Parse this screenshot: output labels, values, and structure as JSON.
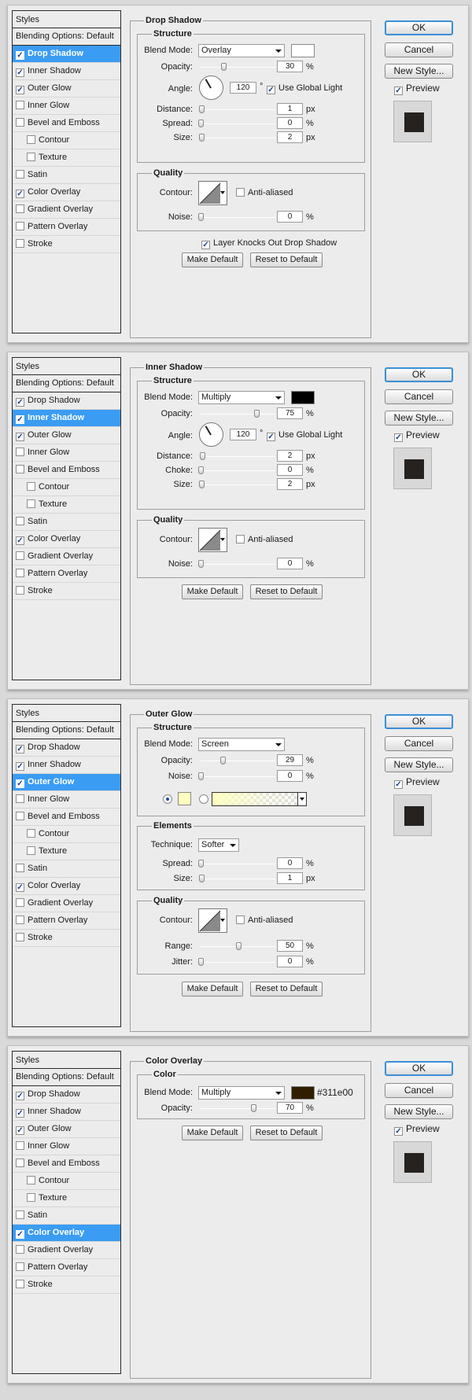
{
  "dialog": {
    "styles_header": "Styles",
    "blending_options": "Blending Options: Default",
    "style_items": [
      "Drop Shadow",
      "Inner Shadow",
      "Outer Glow",
      "Inner Glow",
      "Bevel and Emboss",
      "Contour",
      "Texture",
      "Satin",
      "Color Overlay",
      "Gradient Overlay",
      "Pattern Overlay",
      "Stroke"
    ],
    "ok_label": "OK",
    "cancel_label": "Cancel",
    "new_style_label": "New Style...",
    "preview_label": "Preview",
    "make_default_label": "Make Default",
    "reset_to_default_label": "Reset to Default",
    "checkmark": "✓",
    "preview_color": "#262220"
  },
  "panels": [
    {
      "selected": "Drop Shadow",
      "checked": [
        "Drop Shadow",
        "Inner Shadow",
        "Outer Glow",
        "Color Overlay"
      ],
      "group_title": "Drop Shadow",
      "structure_title": "Structure",
      "blend_mode_label": "Blend Mode:",
      "blend_mode": "Overlay",
      "swatch_color": "#ffffff",
      "opacity_label": "Opacity:",
      "opacity": "30",
      "opacity_unit": "%",
      "angle_label": "Angle:",
      "angle": "120",
      "angle_unit": "°",
      "use_global_light": "Use Global Light",
      "distance_label": "Distance:",
      "distance": "1",
      "distance_unit": "px",
      "spread_label": "Spread:",
      "spread": "0",
      "spread_unit": "%",
      "size_label": "Size:",
      "size": "2",
      "size_unit": "px",
      "quality_title": "Quality",
      "contour_label": "Contour:",
      "anti_aliased": "Anti-aliased",
      "noise_label": "Noise:",
      "noise": "0",
      "noise_unit": "%",
      "layer_knocks_out": "Layer Knocks Out Drop Shadow"
    },
    {
      "selected": "Inner Shadow",
      "checked": [
        "Drop Shadow",
        "Inner Shadow",
        "Outer Glow",
        "Color Overlay"
      ],
      "group_title": "Inner Shadow",
      "structure_title": "Structure",
      "blend_mode_label": "Blend Mode:",
      "blend_mode": "Multiply",
      "swatch_color": "#000000",
      "opacity_label": "Opacity:",
      "opacity": "75",
      "opacity_unit": "%",
      "angle_label": "Angle:",
      "angle": "120",
      "angle_unit": "°",
      "use_global_light": "Use Global Light",
      "distance_label": "Distance:",
      "distance": "2",
      "distance_unit": "px",
      "choke_label": "Choke:",
      "choke": "0",
      "choke_unit": "%",
      "size_label": "Size:",
      "size": "2",
      "size_unit": "px",
      "quality_title": "Quality",
      "contour_label": "Contour:",
      "anti_aliased": "Anti-aliased",
      "noise_label": "Noise:",
      "noise": "0",
      "noise_unit": "%"
    },
    {
      "selected": "Outer Glow",
      "checked": [
        "Drop Shadow",
        "Inner Shadow",
        "Outer Glow",
        "Color Overlay"
      ],
      "group_title": "Outer Glow",
      "structure_title": "Structure",
      "blend_mode_label": "Blend Mode:",
      "blend_mode": "Screen",
      "opacity_label": "Opacity:",
      "opacity": "29",
      "opacity_unit": "%",
      "noise_label": "Noise:",
      "noise": "0",
      "noise_unit": "%",
      "glow_color": "#ffffc0",
      "elements_title": "Elements",
      "technique_label": "Technique:",
      "technique": "Softer",
      "spread_label": "Spread:",
      "spread": "0",
      "spread_unit": "%",
      "size_label": "Size:",
      "size": "1",
      "size_unit": "px",
      "quality_title": "Quality",
      "contour_label": "Contour:",
      "anti_aliased": "Anti-aliased",
      "range_label": "Range:",
      "range": "50",
      "range_unit": "%",
      "jitter_label": "Jitter:",
      "jitter": "0",
      "jitter_unit": "%"
    },
    {
      "selected": "Color Overlay",
      "checked": [
        "Drop Shadow",
        "Inner Shadow",
        "Outer Glow",
        "Color Overlay"
      ],
      "group_title": "Color Overlay",
      "color_title": "Color",
      "blend_mode_label": "Blend Mode:",
      "blend_mode": "Multiply",
      "swatch_color": "#311e00",
      "hex_label": "#311e00",
      "opacity_label": "Opacity:",
      "opacity": "70",
      "opacity_unit": "%"
    }
  ]
}
